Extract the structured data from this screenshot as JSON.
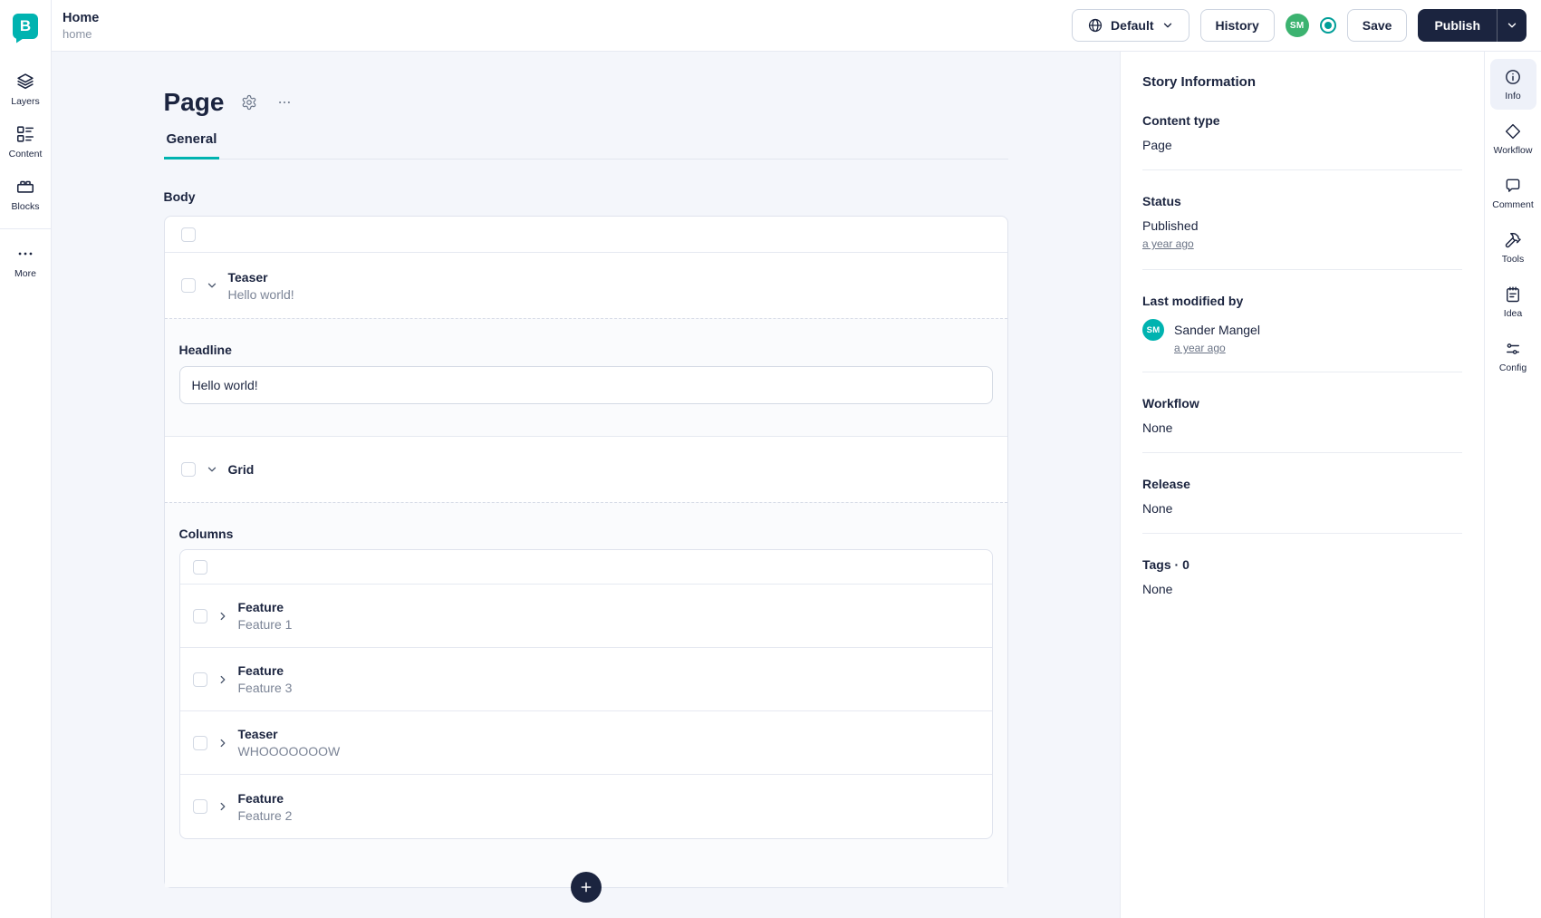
{
  "colors": {
    "accent": "#00b3b0",
    "navy": "#1b243f",
    "avatar_green": "#3cb370"
  },
  "left_rail": {
    "logo_letter": "B",
    "items": [
      {
        "label": "Layers",
        "icon": "layers-icon"
      },
      {
        "label": "Content",
        "icon": "content-icon"
      },
      {
        "label": "Blocks",
        "icon": "blocks-icon"
      },
      {
        "label": "More",
        "icon": "more-icon"
      }
    ]
  },
  "top_bar": {
    "story_title": "Home",
    "story_slug": "home",
    "language_button": {
      "label": "Default",
      "icon": "globe-icon"
    },
    "history_button": "History",
    "user_avatar_initials": "SM",
    "mode_indicator_icon": "radio-dot-icon",
    "save_button": "Save",
    "publish_button": "Publish"
  },
  "editor": {
    "page_title": "Page",
    "settings_icon": "gear-icon",
    "more_icon": "ellipsis-icon",
    "tabs": [
      {
        "label": "General",
        "active": true
      }
    ],
    "body": {
      "label": "Body",
      "teaser": {
        "title": "Teaser",
        "subtitle": "Hello world!",
        "headline_label": "Headline",
        "headline_value": "Hello world!"
      },
      "grid": {
        "title": "Grid",
        "columns_label": "Columns",
        "columns": [
          {
            "title": "Feature",
            "subtitle": "Feature 1"
          },
          {
            "title": "Feature",
            "subtitle": "Feature 3"
          },
          {
            "title": "Teaser",
            "subtitle": "WHOOOOOOOW"
          },
          {
            "title": "Feature",
            "subtitle": "Feature 2"
          }
        ]
      }
    },
    "add_block_icon": "plus-icon"
  },
  "story_panel": {
    "title": "Story Information",
    "content_type_label": "Content type",
    "content_type_value": "Page",
    "status_label": "Status",
    "status_value": "Published",
    "status_time": "a year ago",
    "last_modified_label": "Last modified by",
    "last_modified_initials": "SM",
    "last_modified_user": "Sander Mangel",
    "last_modified_time": "a year ago",
    "workflow_label": "Workflow",
    "workflow_value": "None",
    "release_label": "Release",
    "release_value": "None",
    "tags_label": "Tags · 0",
    "tags_value": "None"
  },
  "right_rail": {
    "items": [
      {
        "label": "Info",
        "icon": "info-icon",
        "active": true
      },
      {
        "label": "Workflow",
        "icon": "workflow-icon",
        "active": false
      },
      {
        "label": "Comment",
        "icon": "comment-icon",
        "active": false
      },
      {
        "label": "Tools",
        "icon": "tools-icon",
        "active": false
      },
      {
        "label": "Idea",
        "icon": "idea-icon",
        "active": false
      },
      {
        "label": "Config",
        "icon": "config-icon",
        "active": false
      }
    ]
  }
}
